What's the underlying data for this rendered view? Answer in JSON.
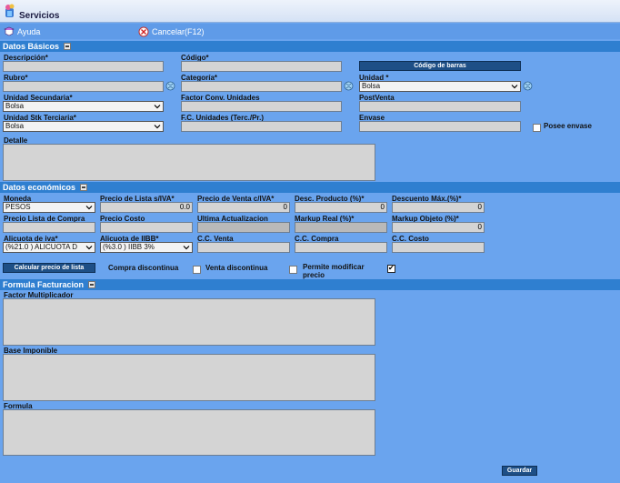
{
  "app": {
    "title": "Servicios"
  },
  "toolbar": {
    "help_label": "Ayuda",
    "cancel_label": "Cancelar(F12)"
  },
  "sections": {
    "basic": "Datos Básicos",
    "economic": "Datos económicos",
    "billing": "Formula Facturacion"
  },
  "basic": {
    "descripcion": {
      "label": "Descripción*",
      "value": ""
    },
    "codigo": {
      "label": "Código*",
      "value": ""
    },
    "barcode_button": "Código de barras",
    "rubro": {
      "label": "Rubro*",
      "value": ""
    },
    "categoria": {
      "label": "Categoría*",
      "value": ""
    },
    "unidad": {
      "label": "Unidad *",
      "value": "Bolsa"
    },
    "unidad_secundaria": {
      "label": "Unidad Secundaria*",
      "value": "Bolsa"
    },
    "factor_conv": {
      "label": "Factor Conv. Unidades",
      "value": ""
    },
    "postventa": {
      "label": "PostVenta",
      "value": ""
    },
    "unidad_stk": {
      "label": "Unidad Stk Terciaria*",
      "value": "Bolsa"
    },
    "fc_unidades": {
      "label": "F.C. Unidades (Terc./Pr.)",
      "value": ""
    },
    "envase": {
      "label": "Envase",
      "value": ""
    },
    "posee_envase": {
      "label": "Posee envase",
      "checked": false
    },
    "detalle": {
      "label": "Detalle"
    }
  },
  "economic": {
    "moneda": {
      "label": "Moneda",
      "value": "PESOS"
    },
    "precio_lista": {
      "label": "Precio de Lista s/IVA*",
      "value": "0.0"
    },
    "precio_venta": {
      "label": "Precio de Venta c/IVA*",
      "value": "0"
    },
    "desc_producto": {
      "label": "Desc. Producto (%)*",
      "value": "0"
    },
    "descuento_max": {
      "label": "Descuento Máx.(%)*",
      "value": "0"
    },
    "precio_lista_compra": {
      "label": "Precio Lista de Compra",
      "value": ""
    },
    "precio_costo": {
      "label": "Precio Costo",
      "value": ""
    },
    "ultima_actualizacion": {
      "label": "Ultima Actualizacion",
      "value": ""
    },
    "markup_real": {
      "label": "Markup Real (%)*",
      "value": ""
    },
    "markup_objeto": {
      "label": "Markup Objeto (%)*",
      "value": "0"
    },
    "alicuota_iva": {
      "label": "Alicuota de iva*",
      "value": "(%21.0 ) ALICUOTA D"
    },
    "alicuota_iibb": {
      "label": "Alicuota de IIBB*",
      "value": "(%3.0 ) IIBB 3%"
    },
    "cc_venta": {
      "label": "C.C. Venta",
      "value": ""
    },
    "cc_compra": {
      "label": "C.C. Compra",
      "value": ""
    },
    "cc_costo": {
      "label": "C.C. Costo",
      "value": ""
    },
    "calc_button": "Calcular precio de lista",
    "compra_discontinua": {
      "label": "Compra discontinua",
      "checked": false
    },
    "venta_discontinua": {
      "label": "Venta discontinua",
      "checked": false
    },
    "permite_modificar": {
      "label": "Permite modificar precio",
      "checked": true
    }
  },
  "billing": {
    "factor": {
      "label": "Factor Multiplicador"
    },
    "base": {
      "label": "Base Imponible"
    },
    "formula": {
      "label": "Formula"
    }
  },
  "footer": {
    "save_label": "Guardar"
  },
  "colors": {
    "background": "#6aa4ee",
    "section_bar": "#2f7fd0",
    "button": "#1e4f86"
  }
}
